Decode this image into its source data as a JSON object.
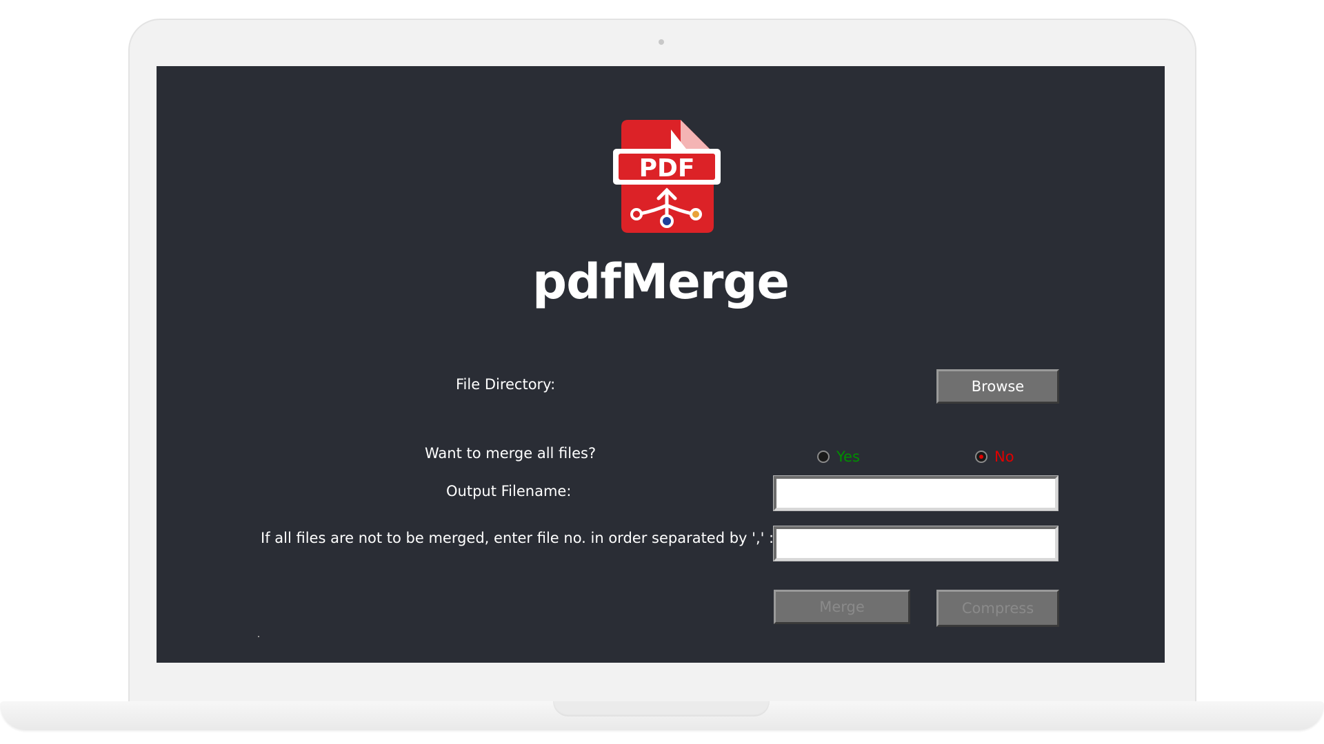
{
  "app": {
    "title": "pdfMerge",
    "logo_text": "PDF"
  },
  "form": {
    "file_directory_label": "File Directory:",
    "browse_label": "Browse",
    "merge_all_label": "Want to merge all files?",
    "yes_label": "Yes",
    "no_label": "No",
    "selected_option": "No",
    "output_filename_label": "Output Filename:",
    "output_filename_value": "",
    "order_label": "If all files are not to be merged, enter file no. in order separated by ',' :",
    "order_value": "",
    "merge_label": "Merge",
    "compress_label": "Compress"
  },
  "colors": {
    "background": "#2a2d35",
    "logo_red": "#dc2227",
    "yes_color": "#008f00",
    "no_color": "#e00000",
    "button_gray": "#707070",
    "disabled_text": "#8a8a8a"
  },
  "icons": {
    "logo": "pdf-merge-document-icon"
  }
}
